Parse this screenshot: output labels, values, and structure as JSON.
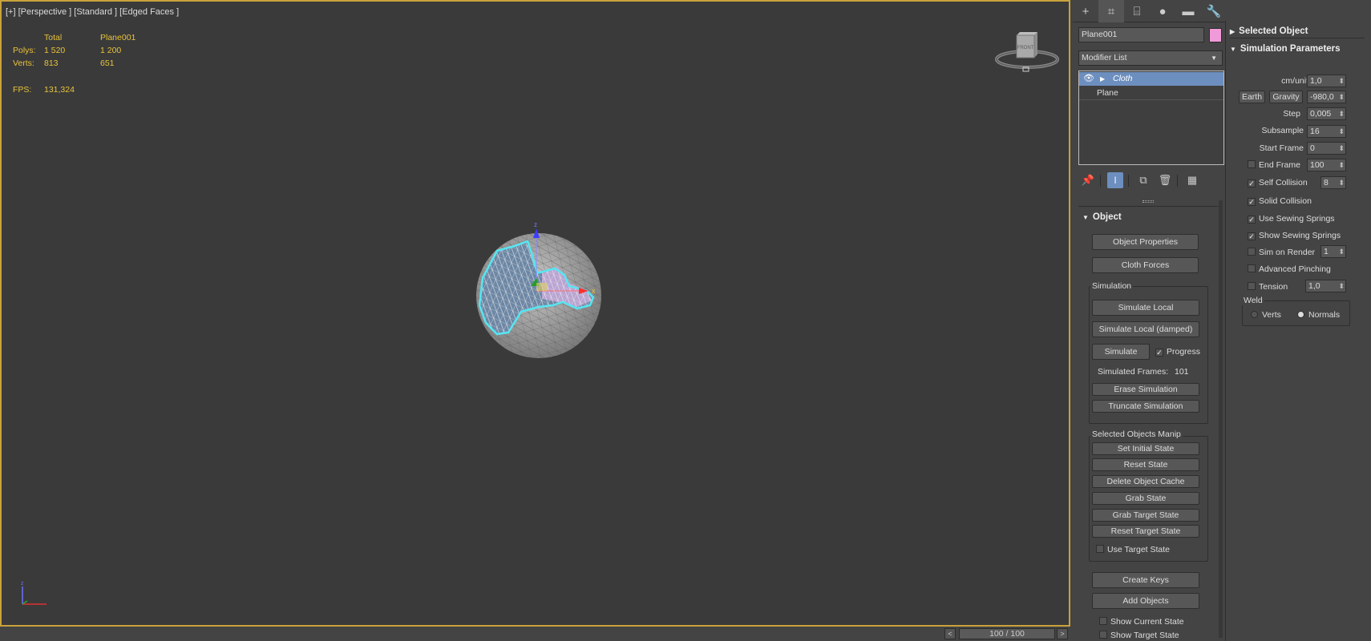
{
  "viewport": {
    "label": "[+] [Perspective ] [Standard ] [Edged Faces ]",
    "stats": {
      "header_total": "Total",
      "header_object": "Plane001",
      "polys_label": "Polys:",
      "polys_total": "1 520",
      "polys_object": "1 200",
      "verts_label": "Verts:",
      "verts_total": "813",
      "verts_object": "651",
      "fps_label": "FPS:",
      "fps_value": "131,324"
    },
    "viewcube_face": "FRONT",
    "gizmo_x": "x",
    "gizmo_z": "z"
  },
  "timeline": {
    "prev": "<",
    "next": ">",
    "position": "100 / 100"
  },
  "command_panel": {
    "tabs": [
      {
        "name": "create-icon",
        "glyph": "+"
      },
      {
        "name": "modify-icon",
        "glyph": "⌗"
      },
      {
        "name": "hierarchy-icon",
        "glyph": "⌸"
      },
      {
        "name": "motion-icon",
        "glyph": "●"
      },
      {
        "name": "display-icon",
        "glyph": "▬"
      },
      {
        "name": "utilities-icon",
        "glyph": "🔧"
      }
    ],
    "object_name": "Plane001",
    "object_color": "#f09ad9",
    "modifier_list": "Modifier List",
    "stack": {
      "cloth": "Cloth",
      "plane": "Plane"
    },
    "object_rollout": {
      "title": "Object",
      "object_properties": "Object Properties",
      "cloth_forces": "Cloth Forces",
      "simulation_group": "Simulation",
      "simulate_local": "Simulate Local",
      "simulate_local_damped": "Simulate Local (damped)",
      "simulate": "Simulate",
      "progress": "Progress",
      "simulated_frames_label": "Simulated Frames:",
      "simulated_frames_value": "101",
      "erase_simulation": "Erase Simulation",
      "truncate_simulation": "Truncate Simulation",
      "selected_group": "Selected Objects Manip",
      "set_initial_state": "Set Initial State",
      "reset_state": "Reset State",
      "delete_object_cache": "Delete Object Cache",
      "grab_state": "Grab State",
      "grab_target_state": "Grab Target State",
      "reset_target_state": "Reset Target State",
      "use_target_state": "Use Target State",
      "create_keys": "Create Keys",
      "add_objects": "Add Objects",
      "show_current_state": "Show Current State",
      "show_target_state": "Show Target State"
    }
  },
  "right_panel": {
    "selected_object": "Selected Object",
    "sim_params": "Simulation Parameters",
    "cm_unit_label": "cm/unit",
    "cm_unit_value": "1,0",
    "earth": "Earth",
    "gravity": "Gravity",
    "gravity_value": "-980,0",
    "step_label": "Step",
    "step_value": "0,005",
    "subsample_label": "Subsample",
    "subsample_value": "16",
    "start_frame_label": "Start Frame",
    "start_frame_value": "0",
    "end_frame_label": "End Frame",
    "end_frame_value": "100",
    "self_collision": "Self Collision",
    "self_collision_value": "8",
    "solid_collision": "Solid Collision",
    "use_sewing_springs": "Use Sewing Springs",
    "show_sewing_springs": "Show Sewing Springs",
    "sim_on_render": "Sim on Render",
    "sim_on_render_value": "1",
    "advanced_pinching": "Advanced Pinching",
    "tension": "Tension",
    "tension_value": "1,0",
    "weld": "Weld",
    "verts": "Verts",
    "normals": "Normals"
  }
}
